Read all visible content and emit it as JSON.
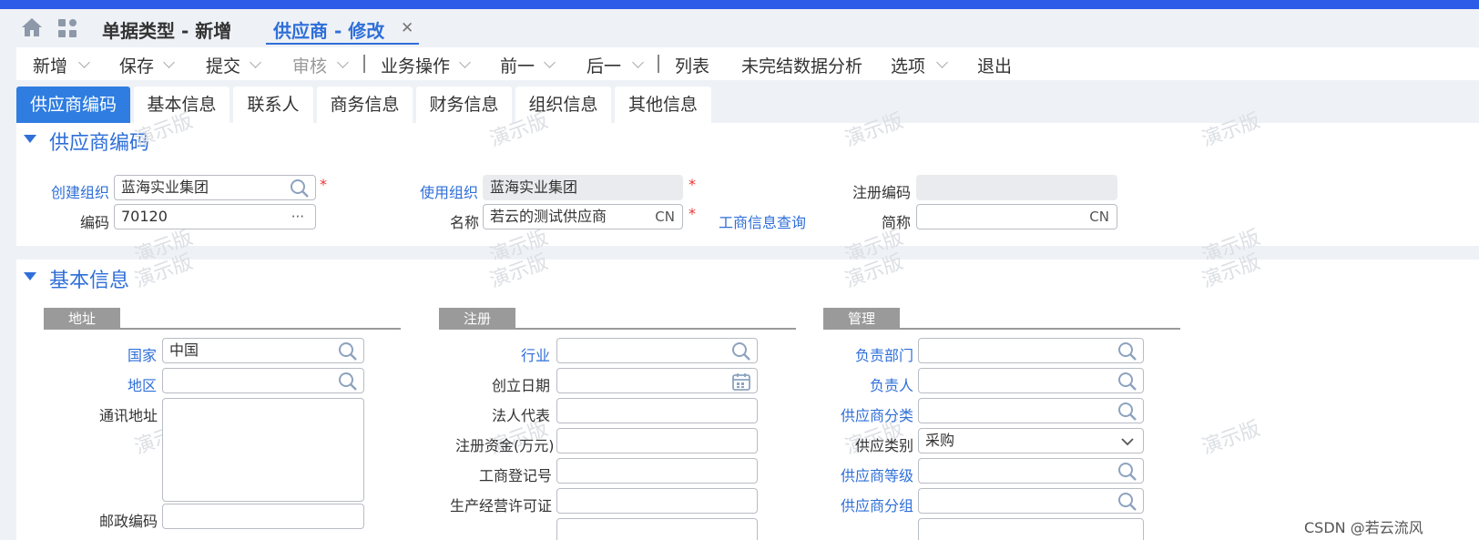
{
  "window_tabs": [
    {
      "label": "单据类型 - 新增",
      "active": false
    },
    {
      "label": "供应商 - 修改",
      "active": true
    }
  ],
  "toolbar": {
    "items": [
      "新增",
      "保存",
      "提交",
      "审核",
      "业务操作",
      "前一",
      "后一",
      "列表",
      "未完结数据分析",
      "选项",
      "退出"
    ]
  },
  "page_tabs": [
    "供应商编码",
    "基本信息",
    "联系人",
    "商务信息",
    "财务信息",
    "组织信息",
    "其他信息"
  ],
  "section1": {
    "title": "供应商编码",
    "create_org_label": "创建组织",
    "create_org_value": "蓝海实业集团",
    "code_label": "编码",
    "code_value": "70120",
    "code_suffix": "···",
    "use_org_label": "使用组织",
    "use_org_value": "蓝海实业集团",
    "name_label": "名称",
    "name_value": "若云的测试供应商",
    "name_suffix": "CN",
    "biz_query_link": "工商信息查询",
    "reg_code_label": "注册编码",
    "reg_code_value": "",
    "short_name_label": "简称",
    "short_name_value": "",
    "short_name_suffix": "CN",
    "required_mark": "*"
  },
  "section2": {
    "title": "基本信息",
    "address_group": "地址",
    "register_group": "注册",
    "manage_group": "管理",
    "country_label": "国家",
    "country_value": "中国",
    "region_label": "地区",
    "region_value": "",
    "mail_address_label": "通讯地址",
    "mail_address_value": "",
    "postcode_label": "邮政编码",
    "industry_label": "行业",
    "found_date_label": "创立日期",
    "legal_rep_label": "法人代表",
    "reg_capital_label": "注册资金(万元)",
    "biz_reg_no_label": "工商登记号",
    "prod_license_label": "生产经营许可证",
    "dept_label": "负责部门",
    "owner_label": "负责人",
    "supplier_class_label": "供应商分类",
    "supplier_type_label": "供应类别",
    "supplier_type_value": "采购",
    "supplier_level_label": "供应商等级",
    "supplier_group_label": "供应商分组"
  },
  "watermark": "演示版",
  "footer": {
    "credit": "CSDN @若云流风"
  },
  "colors": {
    "brand_blue": "#2d5ce8",
    "accent_blue": "#2f7de1",
    "link_blue": "#2f6fd8",
    "required_red": "#e33"
  }
}
